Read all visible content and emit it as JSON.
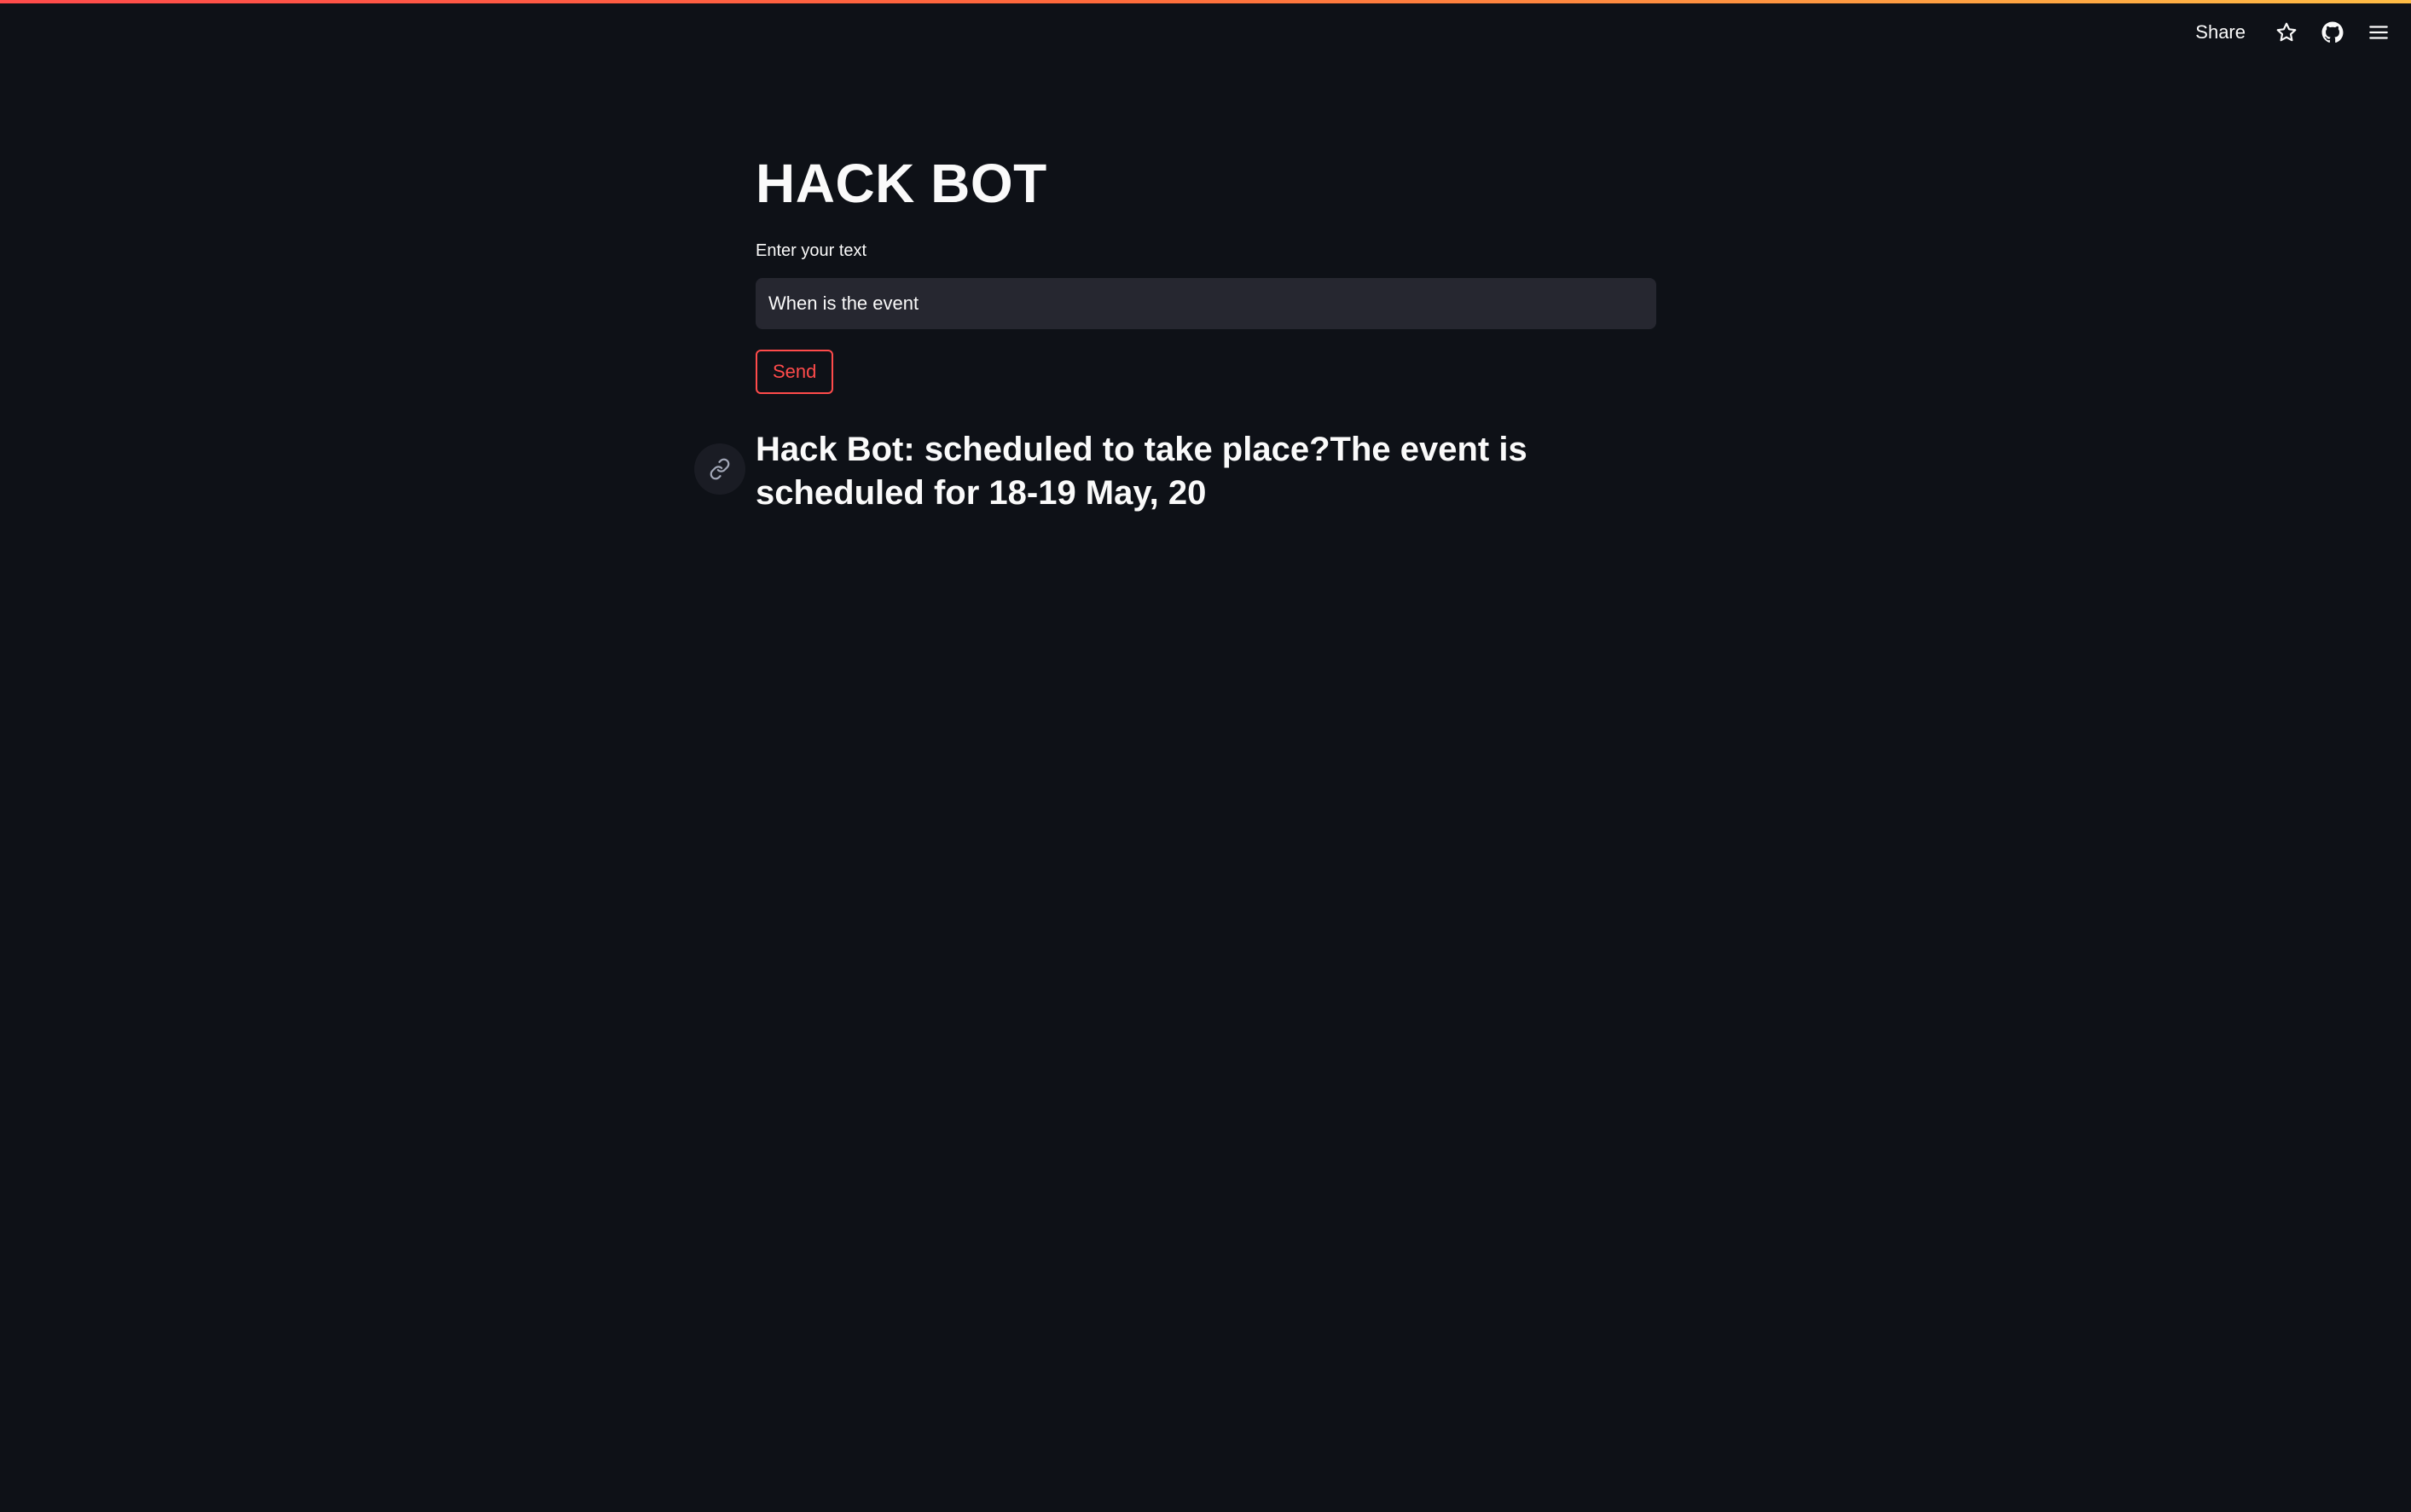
{
  "header": {
    "share_label": "Share",
    "icons": [
      "star-icon",
      "github-icon",
      "hamburger-menu-icon"
    ]
  },
  "main": {
    "title": "HACK BOT",
    "input": {
      "label": "Enter your text",
      "value": "When is the event"
    },
    "send_label": "Send",
    "answer": "Hack Bot: scheduled to take place?The event is scheduled for 18-19 May, 20"
  },
  "colors": {
    "background": "#0e1117",
    "input_background": "#262730",
    "accent": "#ff4b4b",
    "text": "#fafafa"
  }
}
